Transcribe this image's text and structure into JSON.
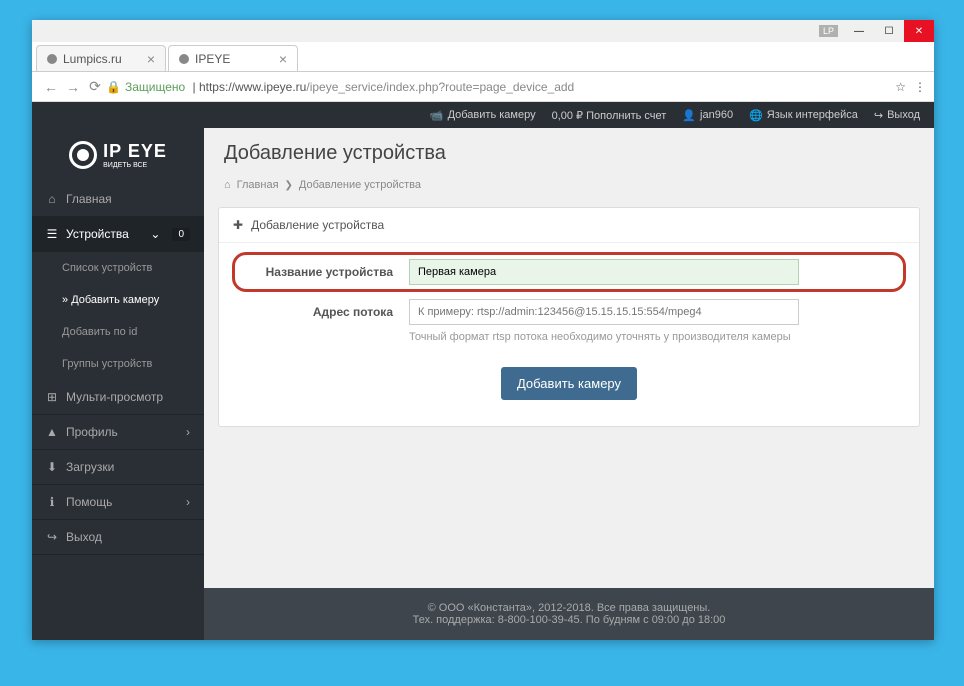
{
  "window": {
    "lp": "LP"
  },
  "tabs": [
    {
      "title": "Lumpics.ru"
    },
    {
      "title": "IPEYE"
    }
  ],
  "address": {
    "secure": "Защищено",
    "host": "https://www.ipeye.ru",
    "path": "/ipeye_service/index.php?route=page_device_add"
  },
  "topbar": {
    "add_camera": "Добавить камеру",
    "balance": "0,00 ₽ Пополнить счет",
    "user": "jan960",
    "lang": "Язык интерфейса",
    "exit": "Выход"
  },
  "logo": {
    "brand": "IP EYE",
    "tag": "ВИДЕТЬ ВСЕ"
  },
  "nav": {
    "home": "Главная",
    "devices": "Устройства",
    "devices_badge": "0",
    "device_list": "Список устройств",
    "add_camera": "Добавить камеру",
    "add_by_id": "Добавить по id",
    "device_groups": "Группы устройств",
    "multi": "Мульти-просмотр",
    "profile": "Профиль",
    "downloads": "Загрузки",
    "help": "Помощь",
    "exit": "Выход"
  },
  "page": {
    "title": "Добавление устройства",
    "breadcrumb_home": "Главная",
    "breadcrumb_current": "Добавление устройства",
    "panel_title": "Добавление устройства",
    "name_label": "Название устройства",
    "name_value": "Первая камера",
    "stream_label": "Адрес потока",
    "stream_placeholder": "К примеру: rtsp://admin:123456@15.15.15.15:554/mpeg4",
    "stream_hint": "Точный формат rtsp потока необходимо уточнять у производителя камеры",
    "submit": "Добавить камеру"
  },
  "footer": {
    "line1": "© ООО «Константа», 2012-2018. Все права защищены.",
    "line2": "Тех. поддержка: 8-800-100-39-45. По будням с 09:00 до 18:00"
  }
}
